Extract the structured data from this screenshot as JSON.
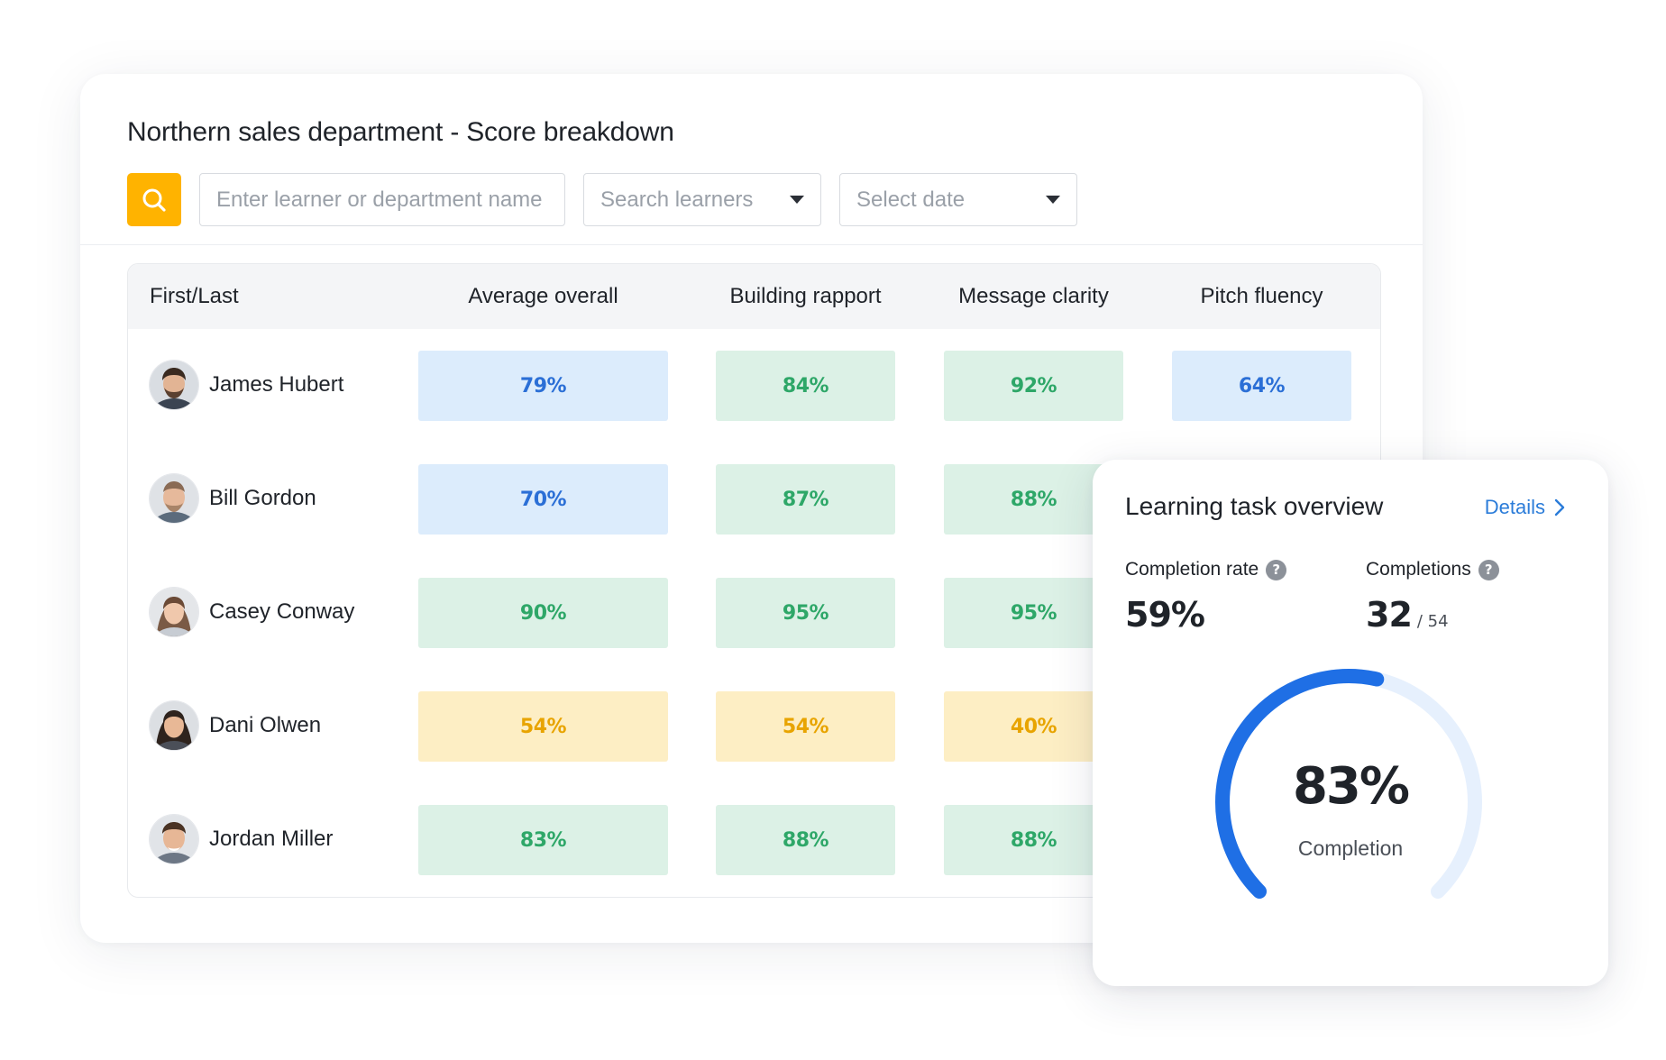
{
  "header": {
    "title": "Northern sales department - Score breakdown"
  },
  "filters": {
    "search_icon": "search-icon",
    "name_input_placeholder": "Enter learner or department name",
    "learner_select_placeholder": "Search learners",
    "date_select_placeholder": "Select date"
  },
  "table": {
    "columns": [
      "First/Last",
      "Average overall",
      "Building rapport",
      "Message clarity",
      "Pitch fluency"
    ],
    "rows": [
      {
        "name": "James Hubert",
        "scores": [
          "79%",
          "84%",
          "92%",
          "64%"
        ],
        "levels": [
          "blue",
          "green",
          "green",
          "blue"
        ]
      },
      {
        "name": "Bill Gordon",
        "scores": [
          "70%",
          "87%",
          "88%"
        ],
        "levels": [
          "blue",
          "green",
          "green"
        ]
      },
      {
        "name": "Casey Conway",
        "scores": [
          "90%",
          "95%",
          "95%"
        ],
        "levels": [
          "green",
          "green",
          "green"
        ]
      },
      {
        "name": "Dani Olwen",
        "scores": [
          "54%",
          "54%",
          "40%"
        ],
        "levels": [
          "yellow",
          "yellow",
          "yellow"
        ]
      },
      {
        "name": "Jordan Miller",
        "scores": [
          "83%",
          "88%",
          "88%"
        ],
        "levels": [
          "green",
          "green",
          "green"
        ]
      }
    ]
  },
  "overview": {
    "title": "Learning task overview",
    "details_label": "Details",
    "completion_rate_label": "Completion rate",
    "completion_rate_value": "59%",
    "completions_label": "Completions",
    "completions_value": "32",
    "completions_total": "/ 54",
    "gauge_value": "83%",
    "gauge_fraction": 0.83,
    "gauge_label": "Completion"
  },
  "colors": {
    "accent_search": "#ffb300",
    "score_blue_bg": "#dcecfc",
    "score_blue_text": "#2b6fd6",
    "score_green_bg": "#dcf1e6",
    "score_green_text": "#2ea768",
    "score_yellow_bg": "#fdeec4",
    "score_yellow_text": "#e8a400",
    "gauge_arc": "#1f6fe5",
    "gauge_track": "#e6f0fd",
    "link": "#2b7cd9"
  }
}
